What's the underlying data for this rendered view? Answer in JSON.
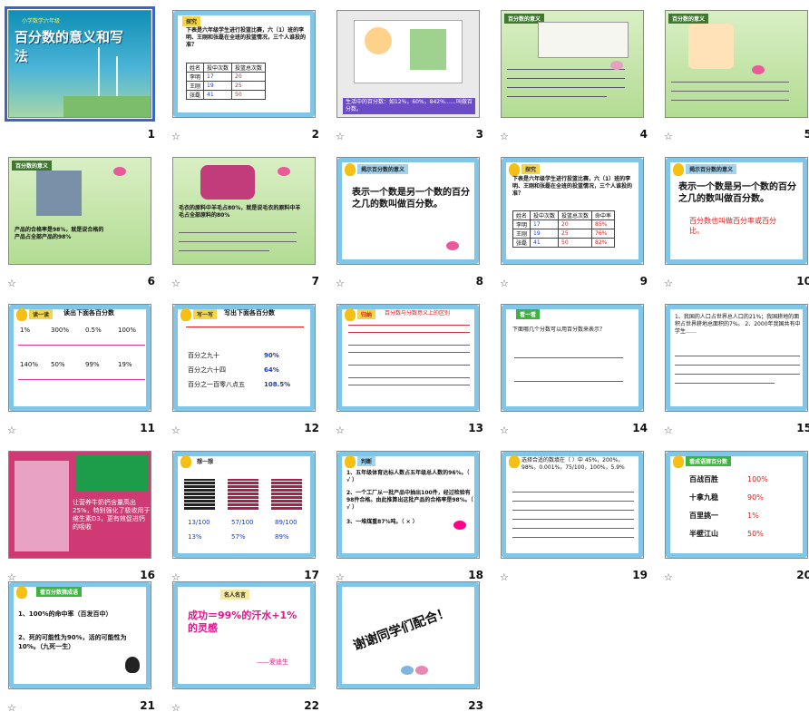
{
  "slides": [
    {
      "number": "1",
      "title": "百分数的意义和写法",
      "subtitle": "小学数学六年级"
    },
    {
      "number": "2",
      "header": "探究",
      "text": "下表是六年级学生进行投篮比赛，六（1）班的李明、王刚和张磊在全班的投篮情况，三个人谁投的准？",
      "table": [
        [
          "姓名",
          "投中次数",
          "投篮总次数"
        ],
        [
          "李明",
          "17",
          "20"
        ],
        [
          "王刚",
          "19",
          "25"
        ],
        [
          "张磊",
          "41",
          "50"
        ]
      ]
    },
    {
      "number": "3",
      "caption": "生活中的百分数：如12%，60%，842%……叫做百分数。"
    },
    {
      "number": "4",
      "header": "百分数的意义"
    },
    {
      "number": "5",
      "header": "百分数的意义"
    },
    {
      "number": "6",
      "header": "百分数的意义",
      "text": "产品的合格率是98%，就是说合格的产品占全部产品的98%"
    },
    {
      "number": "7",
      "text": "毛衣的原料中羊毛占80%，就是说毛衣的原料中羊毛占全部原料的80%"
    },
    {
      "number": "8",
      "header": "揭示百分数的意义",
      "text": "表示一个数是另一个数的百分之几的数叫做百分数。"
    },
    {
      "number": "9",
      "header": "探究",
      "text": "下表是六年级学生进行投篮比赛，六（1）班的李明、王刚和张磊在全班的投篮情况，三个人谁投的准？",
      "table": [
        [
          "姓名",
          "投中次数",
          "投篮总次数",
          "命中率"
        ],
        [
          "李明",
          "17",
          "20",
          "85%"
        ],
        [
          "王刚",
          "19",
          "25",
          "76%"
        ],
        [
          "张磊",
          "41",
          "50",
          "82%"
        ]
      ]
    },
    {
      "number": "10",
      "header": "揭示百分数的意义",
      "text": "表示一个数是另一个数的百分之几的数叫做百分数。",
      "text2": "百分数也叫做百分率或百分比。"
    },
    {
      "number": "11",
      "header": "读一读",
      "title": "读出下面各百分数",
      "items": [
        "1%",
        "300%",
        "0.5%",
        "100%",
        "140%",
        "50%",
        "99%",
        "19%"
      ]
    },
    {
      "number": "12",
      "header": "写一写",
      "title": "写出下面各百分数",
      "items": [
        "百分之九十",
        "百分之六十四",
        "百分之一百零八点五"
      ],
      "answers": [
        "90%",
        "64%",
        "108.5%"
      ]
    },
    {
      "number": "13",
      "header": "归纳",
      "title": "百分数与分数意义上的区别"
    },
    {
      "number": "14",
      "header": "看一看",
      "question": "下面哪几个分数可以用百分数来表示？"
    },
    {
      "number": "15",
      "text": "1、我国的人口占世界总人口的21%；我国耕地的面积占世界耕地总面积的7%。 2、2000年我国共有中学生……"
    },
    {
      "number": "16",
      "text": "让营养牛奶钙含量高出25%，特别强化了极收用于维生素D3，更有效促进钙的吸收"
    },
    {
      "number": "17",
      "header": "想一想",
      "values": [
        "13/100",
        "57/100",
        "89/100"
      ],
      "percents": [
        "13%",
        "57%",
        "89%"
      ]
    },
    {
      "number": "18",
      "header": "判断",
      "items": [
        "1、五年级体育达标人数占五年级总人数的96%。（ √ ）",
        "2、一个工厂从一批产品中抽出100件，经过检验有98件合格。由此推算出这批产品的合格率是98%。（ √ ）",
        "3、一堆煤重87%吨。（ × ）"
      ]
    },
    {
      "number": "19",
      "text": "选择合适的数填在（ ）中 45%，200%，98%，0.001%，75/100，100%，5.9%"
    },
    {
      "number": "20",
      "header": "看成语猜百分数",
      "items": [
        "百战百胜",
        "十拿九稳",
        "百里挑一",
        "半壁江山"
      ],
      "answers": [
        "100%",
        "90%",
        "1%",
        "50%"
      ]
    },
    {
      "number": "21",
      "header": "看百分数猜成语",
      "items": [
        "1、100%的命中率（百发百中）",
        "2、死的可能性为90%，活的可能性为10%。（九死一生）"
      ]
    },
    {
      "number": "22",
      "header": "名人名言",
      "quote": "成功＝99%的汗水+1%的灵感",
      "author": "——爱迪生"
    },
    {
      "number": "23",
      "text": "谢谢同学们配合！"
    }
  ],
  "icons": {
    "transition": "star-transition-icon"
  }
}
